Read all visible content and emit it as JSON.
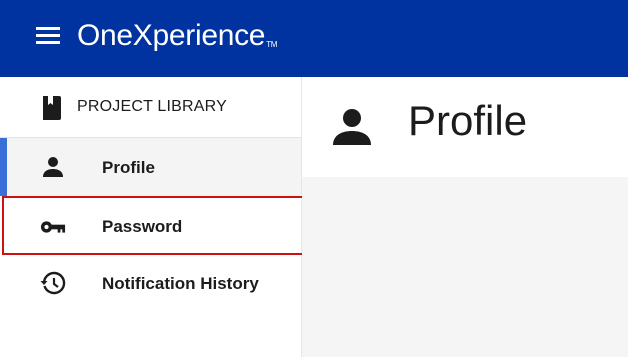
{
  "app": {
    "title": "OneXperience",
    "trademark": "TM"
  },
  "sidebar": {
    "library_label": "PROJECT LIBRARY",
    "items": [
      {
        "label": "Profile",
        "icon": "person-icon",
        "active": true
      },
      {
        "label": "Password",
        "icon": "key-icon",
        "highlighted": true
      },
      {
        "label": "Notification History",
        "icon": "history-icon"
      }
    ]
  },
  "main": {
    "title": "Profile",
    "icon": "person-icon"
  },
  "colors": {
    "brand": "#0033a0",
    "accent": "#3b6fd8",
    "highlight": "#cc1111",
    "active_bg": "#f4f4f4"
  }
}
